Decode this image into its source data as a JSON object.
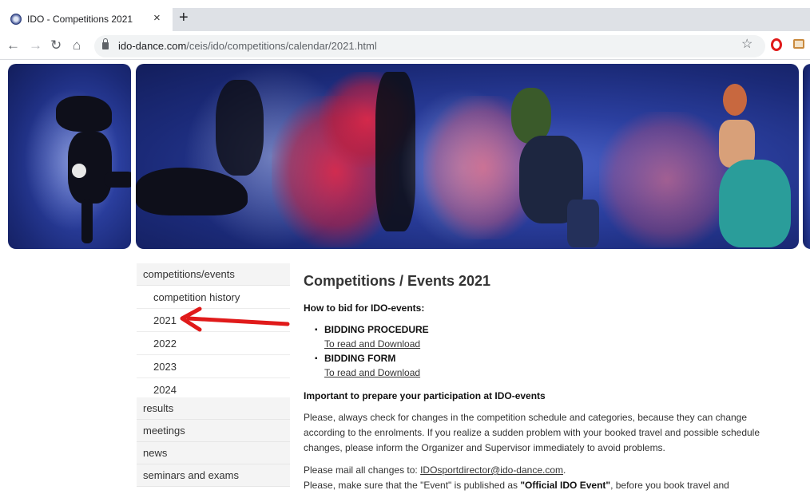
{
  "browser": {
    "tab_title": "IDO - Competitions 2021",
    "tab_close": "×",
    "new_tab": "+",
    "url_host": "ido-dance.com",
    "url_path": "/ceis/ido/competitions/calendar/2021.html",
    "nav": {
      "back": "←",
      "forward": "→",
      "reload": "↻",
      "home": "⌂"
    },
    "star": "☆"
  },
  "sidebar": {
    "section": "competitions/events",
    "sub_items": [
      "competition history",
      "2021",
      "2022",
      "2023",
      "2024"
    ],
    "items": [
      "results",
      "meetings",
      "news",
      "seminars and exams"
    ]
  },
  "content": {
    "title": "Competitions / Events 2021",
    "how_to_bid": "How to bid for IDO-events:",
    "bidding": [
      {
        "label": "BIDDING PROCEDURE",
        "link": "To read and Download"
      },
      {
        "label": "BIDDING FORM",
        "link": "To read and Download"
      }
    ],
    "important": "Important to prepare your participation at IDO-events",
    "paragraph": "Please, always check for changes in the competition schedule and categories, because they can change according to the enrolments. If you realize a sudden problem with your booked travel and possible schedule changes, please inform the Organizer and Supervisor immediately to avoid problems.",
    "mail_prefix": "Please mail all changes to: ",
    "mail_address": "IDOsportdirector@ido-dance.com",
    "mail_suffix": ".",
    "publish_prefix": "Please, make sure that the \"Event\" is published as ",
    "publish_bold": "\"Official IDO Event\"",
    "publish_suffix": ", before you book travel and"
  },
  "colors": {
    "arrow": "#e01a1a",
    "banner_bg": "#1b2a78",
    "sidebar_bg": "#f4f4f4"
  }
}
